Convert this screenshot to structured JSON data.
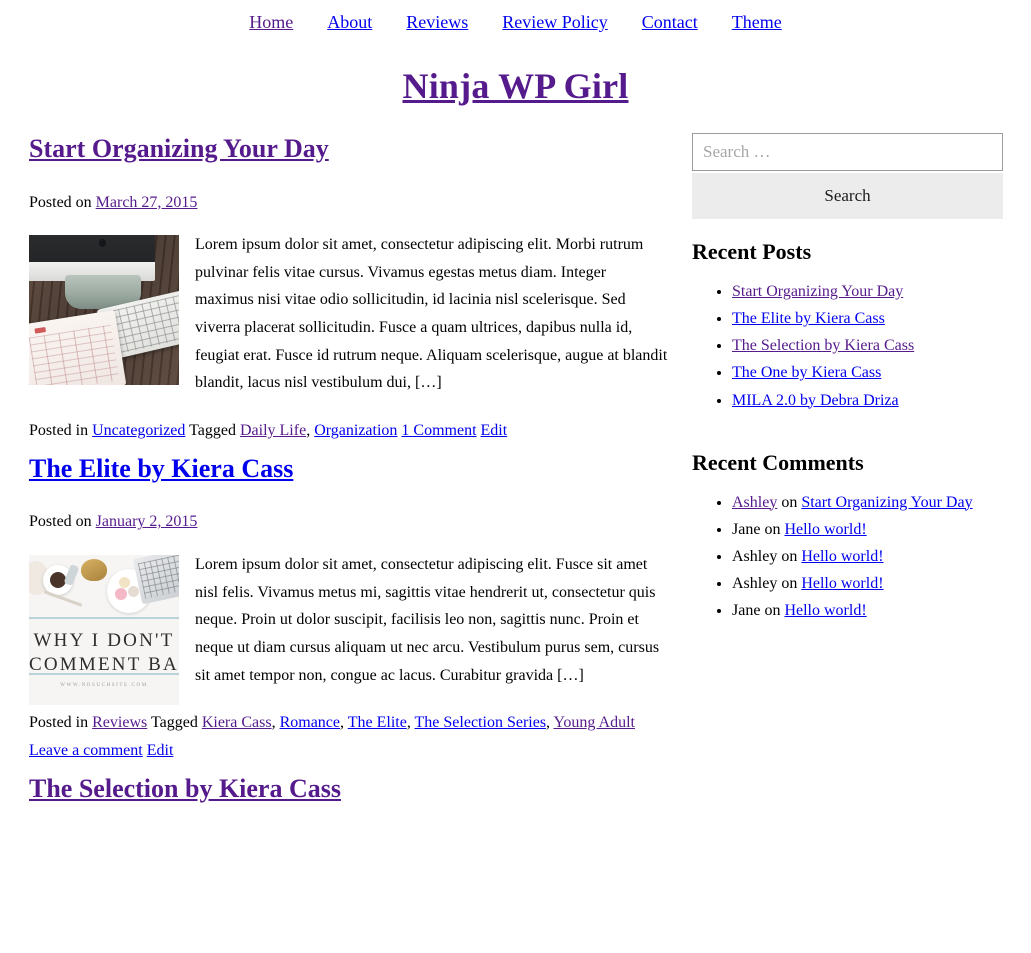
{
  "nav": {
    "items": [
      {
        "label": "Home",
        "state": "visited"
      },
      {
        "label": "About",
        "state": "unvisited"
      },
      {
        "label": "Reviews",
        "state": "unvisited"
      },
      {
        "label": "Review Policy",
        "state": "unvisited"
      },
      {
        "label": "Contact",
        "state": "unvisited"
      },
      {
        "label": "Theme",
        "state": "unvisited"
      }
    ]
  },
  "site": {
    "title": "Ninja WP Girl"
  },
  "posts": [
    {
      "title": "Start Organizing Your Day",
      "title_state": "visited",
      "posted_on_label": "Posted on",
      "date": "March 27, 2015",
      "date_state": "visited",
      "thumbnail": "desk-imac-keyboard-calendar-photo",
      "excerpt": "Lorem ipsum dolor sit amet, consectetur adipiscing elit. Morbi rutrum pulvinar felis vitae cursus. Vivamus egestas metus diam. Integer maximus nisi vitae odio sollicitudin, id lacinia nisl scelerisque. Sed viverra placerat sollicitudin. Fusce a quam ultrices, dapibus nulla id, feugiat erat. Fusce id rutrum neque. Aliquam scelerisque, augue at blandit blandit, lacus nisl vestibulum dui, […]",
      "footer": {
        "posted_in_label": "Posted in",
        "category": {
          "label": "Uncategorized",
          "state": "unvisited"
        },
        "tagged_label": "Tagged",
        "tags": [
          {
            "label": "Daily Life",
            "state": "visited",
            "trailing": ","
          },
          {
            "label": "Organization",
            "state": "unvisited",
            "trailing": ""
          }
        ],
        "comments": {
          "label": "1 Comment",
          "state": "unvisited"
        },
        "edit": {
          "label": "Edit",
          "state": "unvisited"
        }
      }
    },
    {
      "title": "The Elite by Kiera Cass",
      "title_state": "unvisited",
      "posted_on_label": "Posted on",
      "date": "January 2, 2015",
      "date_state": "visited",
      "thumbnail": "flatlay-why-i-dont-comment-back-photo",
      "thumb_overlay_line1": "WHY I DON'T",
      "thumb_overlay_line2": "COMMENT BACK",
      "thumb_overlay_line3": "WWW.NOSUCHSITE.COM",
      "excerpt": "Lorem ipsum dolor sit amet, consectetur adipiscing elit. Fusce sit amet nisl felis. Vivamus metus mi, sagittis vitae hendrerit ut, consectetur quis neque. Proin ut dolor suscipit, facilisis leo non, sagittis nunc. Proin et neque ut diam cursus aliquam ut nec arcu. Vestibulum purus sem, cursus sit amet tempor non, congue ac lacus. Curabitur gravida […]",
      "footer": {
        "posted_in_label": "Posted in",
        "category": {
          "label": "Reviews",
          "state": "visited"
        },
        "tagged_label": "Tagged",
        "tags": [
          {
            "label": "Kiera Cass",
            "state": "visited",
            "trailing": ","
          },
          {
            "label": "Romance",
            "state": "unvisited",
            "trailing": ","
          },
          {
            "label": "The Elite",
            "state": "unvisited",
            "trailing": ","
          },
          {
            "label": "The Selection Series",
            "state": "unvisited",
            "trailing": ","
          },
          {
            "label": "Young Adult",
            "state": "visited",
            "trailing": ""
          }
        ],
        "comments": {
          "label": "Leave a comment",
          "state": "unvisited"
        },
        "edit": {
          "label": "Edit",
          "state": "unvisited"
        }
      }
    },
    {
      "title": "The Selection by Kiera Cass",
      "title_state": "visited"
    }
  ],
  "sidebar": {
    "search": {
      "placeholder": "Search …",
      "value": "",
      "button_label": "Search"
    },
    "recent_posts": {
      "title": "Recent Posts",
      "items": [
        {
          "label": "Start Organizing Your Day",
          "state": "visited"
        },
        {
          "label": "The Elite by Kiera Cass",
          "state": "unvisited"
        },
        {
          "label": "The Selection by Kiera Cass",
          "state": "visited"
        },
        {
          "label": "The One by Kiera Cass",
          "state": "unvisited"
        },
        {
          "label": "MILA 2.0 by Debra Driza",
          "state": "unvisited"
        }
      ]
    },
    "recent_comments": {
      "title": "Recent Comments",
      "on_label": "on",
      "items": [
        {
          "author": "Ashley",
          "author_is_link": true,
          "author_state": "visited",
          "post": "Start Organizing Your Day",
          "post_state": "unvisited"
        },
        {
          "author": "Jane",
          "author_is_link": false,
          "author_state": "",
          "post": "Hello world!",
          "post_state": "unvisited"
        },
        {
          "author": "Ashley",
          "author_is_link": false,
          "author_state": "",
          "post": "Hello world!",
          "post_state": "unvisited"
        },
        {
          "author": "Ashley",
          "author_is_link": false,
          "author_state": "",
          "post": "Hello world!",
          "post_state": "unvisited"
        },
        {
          "author": "Jane",
          "author_is_link": false,
          "author_state": "",
          "post": "Hello world!",
          "post_state": "unvisited"
        }
      ]
    }
  },
  "colors": {
    "link_unvisited": "#0000ee",
    "link_visited": "#551a8b",
    "text": "#000000",
    "button_bg": "#ececec",
    "input_border": "#9b9b9b"
  }
}
